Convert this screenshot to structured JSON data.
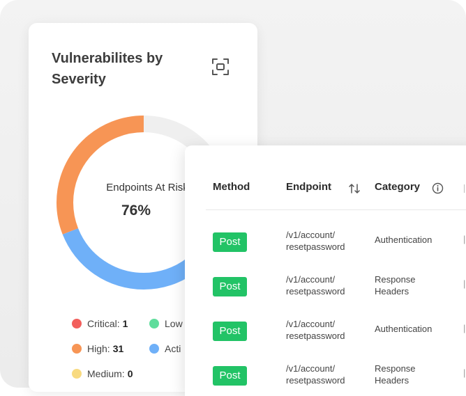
{
  "severity_card": {
    "title": "Vulnerabilites by Severity",
    "center_label": "Endpoints At Risk",
    "center_value": "76%",
    "segments": [
      {
        "name": "Critical",
        "color": "#f25f5c",
        "fraction": 0.05
      },
      {
        "name": "High",
        "color": "#f79555",
        "fraction": 0.31
      },
      {
        "name": "Active",
        "color": "#6fb0f8",
        "fraction": 0.4
      },
      {
        "name": "Unfilled",
        "color": "#efefef",
        "fraction": 0.24
      }
    ],
    "legend": [
      {
        "label": "Critical:",
        "count": "1",
        "color": "#f25f5c"
      },
      {
        "label": "High:",
        "count": "31",
        "color": "#f79555"
      },
      {
        "label": "Medium:",
        "count": "0",
        "color": "#f8da80"
      },
      {
        "label": "Low",
        "count": "",
        "color": "#5fdd9c"
      },
      {
        "label": "Acti",
        "count": "",
        "color": "#6fb0f8"
      }
    ],
    "icons": {
      "expand": "expand-frame-icon"
    }
  },
  "endpoints_table": {
    "headers": {
      "method": "Method",
      "endpoint": "Endpoint",
      "category": "Category"
    },
    "icons": {
      "sort": "sort-arrows-icon",
      "info": "info-icon"
    },
    "rows": [
      {
        "method": "Post",
        "endpoint_line1": "/v1/account/",
        "endpoint_line2": "resetpassword",
        "category_line1": "Authentication",
        "category_line2": ""
      },
      {
        "method": "Post",
        "endpoint_line1": "/v1/account/",
        "endpoint_line2": "resetpassword",
        "category_line1": "Response",
        "category_line2": "Headers"
      },
      {
        "method": "Post",
        "endpoint_line1": "/v1/account/",
        "endpoint_line2": "resetpassword",
        "category_line1": "Authentication",
        "category_line2": ""
      },
      {
        "method": "Post",
        "endpoint_line1": "/v1/account/",
        "endpoint_line2": "resetpassword",
        "category_line1": "Response",
        "category_line2": "Headers"
      }
    ]
  }
}
